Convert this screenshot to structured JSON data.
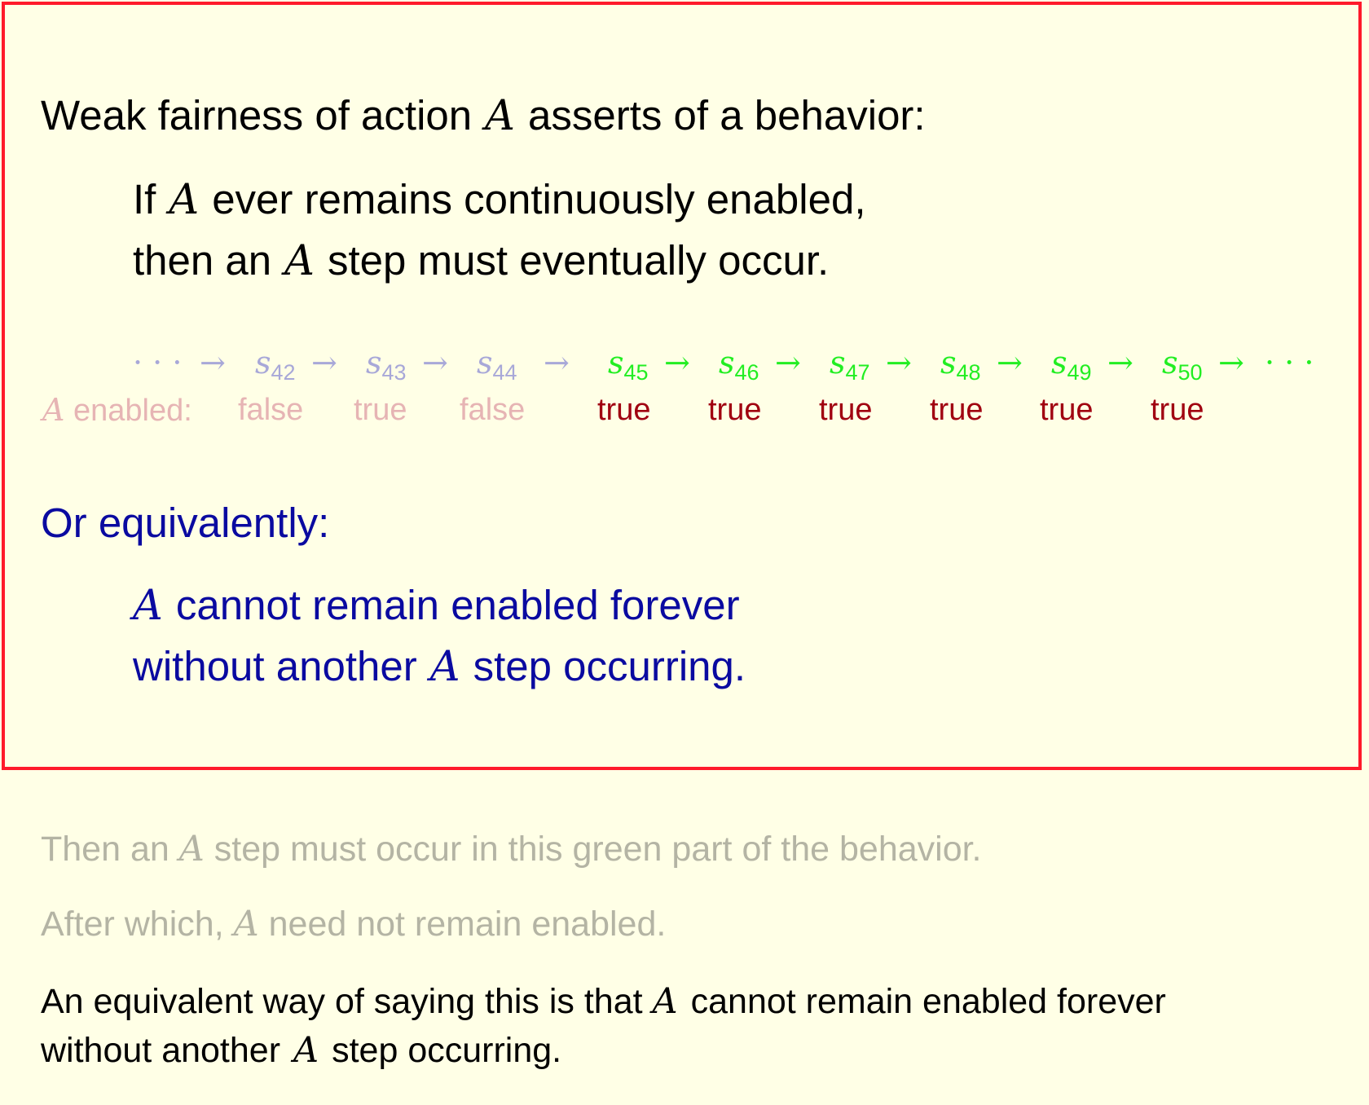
{
  "slide": {
    "heading": {
      "before": "Weak fairness of action",
      "var": "A",
      "after": "asserts of a behavior:"
    },
    "rule": {
      "line1": {
        "before": "If",
        "var": "A",
        "after": "ever remains continuously enabled,"
      },
      "line2": {
        "before": "then an",
        "var": "A",
        "after": "step must eventually occur."
      }
    },
    "behavior": {
      "leading_dots": "· · ·",
      "trailing_dots": "· · ·",
      "arrow": "→",
      "state_symbol": "s",
      "states": [
        {
          "sub": "42",
          "enabled": "false",
          "highlighted": false
        },
        {
          "sub": "43",
          "enabled": "true",
          "highlighted": false
        },
        {
          "sub": "44",
          "enabled": "false",
          "highlighted": false
        },
        {
          "sub": "45",
          "enabled": "true",
          "highlighted": true
        },
        {
          "sub": "46",
          "enabled": "true",
          "highlighted": true
        },
        {
          "sub": "47",
          "enabled": "true",
          "highlighted": true
        },
        {
          "sub": "48",
          "enabled": "true",
          "highlighted": true
        },
        {
          "sub": "49",
          "enabled": "true",
          "highlighted": true
        },
        {
          "sub": "50",
          "enabled": "true",
          "highlighted": true
        }
      ],
      "enabled_label": {
        "var": "A",
        "text": "enabled:"
      }
    },
    "equivalent": {
      "heading": "Or equivalently:",
      "line1": {
        "var": "A",
        "after": "cannot remain enabled forever"
      },
      "line2": {
        "before": "without another",
        "var": "A",
        "after": "step occurring."
      }
    },
    "notes": {
      "n1": {
        "before": "Then an",
        "var": "A",
        "after": "step must occur in this green part of the behavior."
      },
      "n2": {
        "before": "After which,",
        "var": "A",
        "after": "need not remain enabled."
      },
      "n3": {
        "before": "An equivalent way of saying this is that",
        "var": "A",
        "after": "cannot remain enabled forever"
      },
      "n4": {
        "before": "without another",
        "var": "A",
        "after": "step occurring."
      }
    }
  },
  "colors": {
    "background": "#ffffe6",
    "frame_border": "#ff1a2b",
    "equivalent_text": "#0a0aa0",
    "green_state": "#22ee22",
    "enabled_true": "#a00010",
    "faded_enabled": "#e6b4b4",
    "faded_state": "#a8a8d8",
    "faded_note": "#b4b4a4"
  }
}
